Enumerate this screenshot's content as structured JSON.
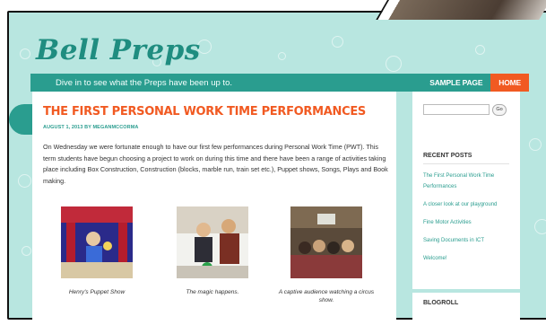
{
  "site": {
    "logo": "Bell Preps",
    "tagline": "Dive in to see what the Preps have been up to."
  },
  "nav": {
    "items": [
      {
        "label": "SAMPLE PAGE",
        "active": false
      },
      {
        "label": "HOME",
        "active": true
      }
    ]
  },
  "post": {
    "title": "THE FIRST PERSONAL WORK TIME PERFORMANCES",
    "meta": "AUGUST 1, 2013 BY MEGANMCCORMA",
    "body": "On Wednesday we were fortunate enough to have our first few performances during Personal Work Time (PWT). This term students have begun choosing a project to work on during this time and there have been a range of activities taking place including Box Construction, Construction (blocks, marble run, train set etc.), Puppet shows, Songs, Plays and Book making.",
    "photos": [
      {
        "caption": "Henry's Puppet Show"
      },
      {
        "caption": "The magic happens."
      },
      {
        "caption": "A captive audience watching a circus show."
      }
    ]
  },
  "sidebar": {
    "search_button": "Go",
    "recent_heading": "RECENT POSTS",
    "recent_posts": [
      "The First Personal Work Time Performances",
      "A closer look at our playground",
      "Fine Motor Activities",
      "Saving Documents in ICT",
      "Welcome!"
    ],
    "blogroll_heading": "BLOGROLL"
  },
  "colors": {
    "background": "#b8e6e0",
    "brand": "#2a9d8f",
    "accent": "#f15a22"
  }
}
